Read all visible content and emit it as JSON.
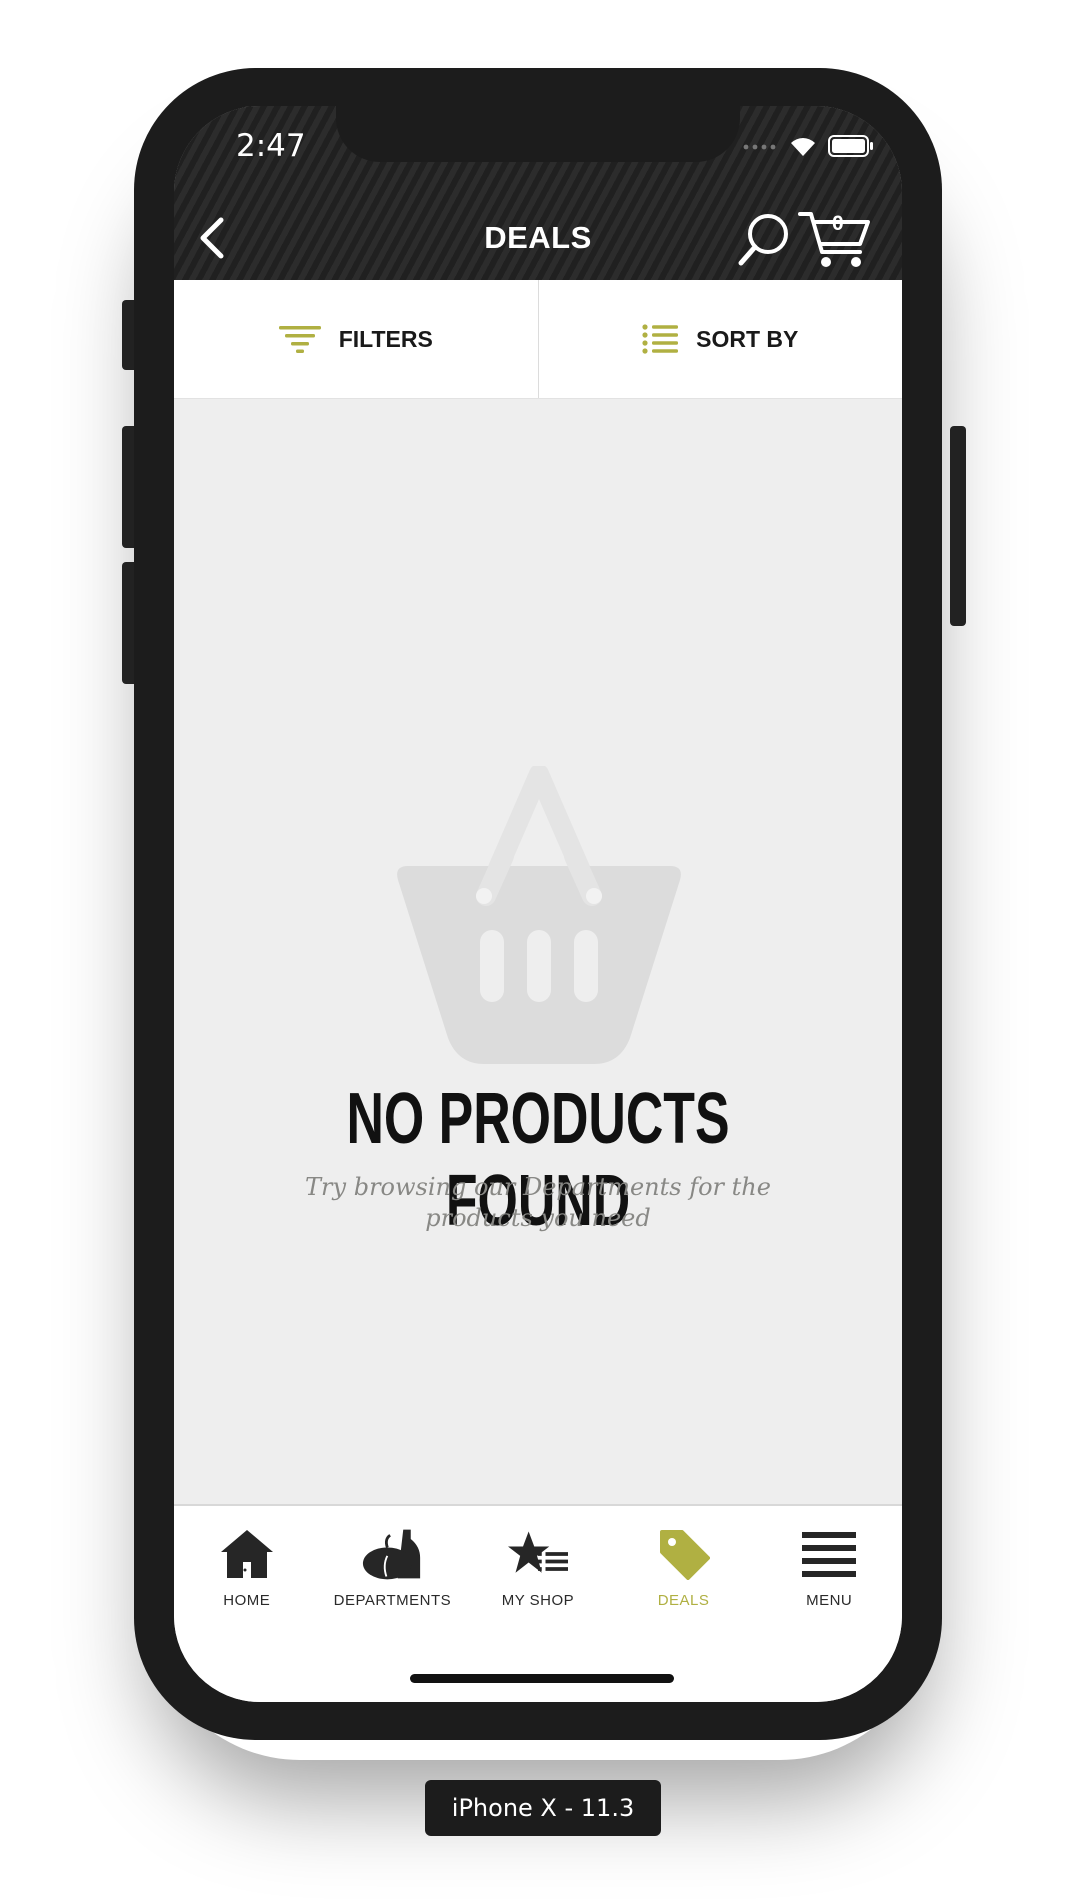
{
  "status_bar": {
    "time": "2:47"
  },
  "header": {
    "title": "DEALS",
    "cart_count": "0"
  },
  "toolbar": {
    "filters_label": "FILTERS",
    "sort_label": "SORT BY",
    "accent_color": "#b0b042"
  },
  "empty_state": {
    "title": "NO PRODUCTS FOUND",
    "subtitle": "Try browsing our Departments for the products you need"
  },
  "tabbar": {
    "items": [
      {
        "label": "HOME",
        "icon": "home-icon",
        "active": false
      },
      {
        "label": "DEPARTMENTS",
        "icon": "departments-icon",
        "active": false
      },
      {
        "label": "MY SHOP",
        "icon": "my-shop-icon",
        "active": false
      },
      {
        "label": "DEALS",
        "icon": "deals-tag-icon",
        "active": true
      },
      {
        "label": "MENU",
        "icon": "menu-icon",
        "active": false
      }
    ]
  },
  "device": {
    "label": "iPhone X - 11.3"
  }
}
